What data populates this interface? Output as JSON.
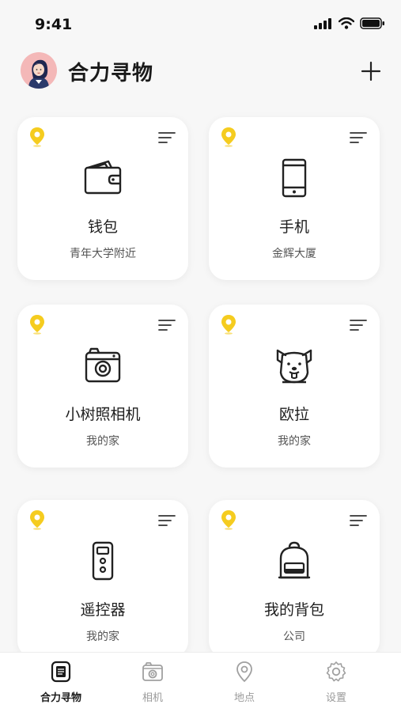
{
  "status_bar": {
    "time": "9:41"
  },
  "header": {
    "title": "合力寻物"
  },
  "cards": [
    {
      "name": "钱包",
      "location": "青年大学附近",
      "icon": "wallet-icon"
    },
    {
      "name": "手机",
      "location": "金辉大厦",
      "icon": "phone-icon"
    },
    {
      "name": "小树照相机",
      "location": "我的家",
      "icon": "camera-icon"
    },
    {
      "name": "欧拉",
      "location": "我的家",
      "icon": "dog-icon"
    },
    {
      "name": "遥控器",
      "location": "我的家",
      "icon": "remote-icon"
    },
    {
      "name": "我的背包",
      "location": "公司",
      "icon": "backpack-icon"
    }
  ],
  "tabs": [
    {
      "label": "合力寻物",
      "icon": "finder-icon",
      "active": true
    },
    {
      "label": "相机",
      "icon": "camera-icon",
      "active": false
    },
    {
      "label": "地点",
      "icon": "location-icon",
      "active": false
    },
    {
      "label": "设置",
      "icon": "gear-icon",
      "active": false
    }
  ],
  "colors": {
    "accent": "#f5cc1f",
    "background": "#f7f7f7",
    "card": "#ffffff",
    "tab_inactive": "#9a9a9a"
  }
}
